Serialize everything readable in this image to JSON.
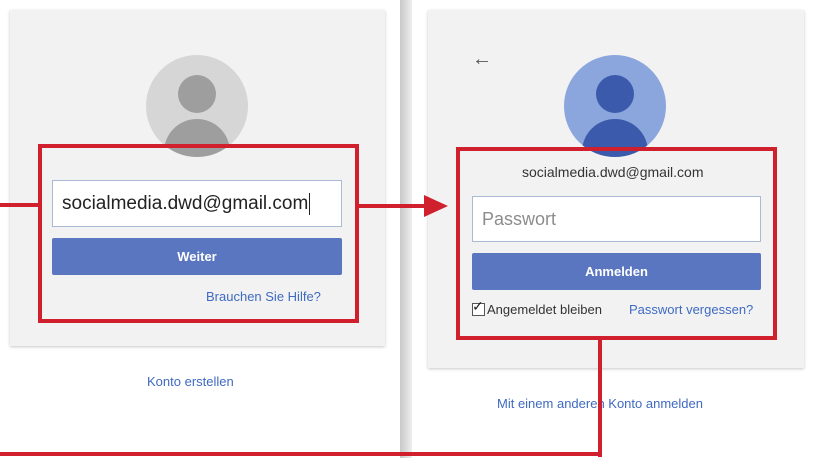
{
  "left_panel": {
    "email_value": "socialmedia.dwd@gmail.com",
    "next_button": "Weiter",
    "help_link": "Brauchen Sie Hilfe?",
    "create_account_link": "Konto erstellen"
  },
  "right_panel": {
    "back_icon": "←",
    "account_email": "socialmedia.dwd@gmail.com",
    "password_placeholder": "Passwort",
    "signin_button": "Anmelden",
    "stay_signed_in_label": "Angemeldet bleiben",
    "stay_signed_in_checked": true,
    "forgot_password_link": "Passwort vergessen?",
    "other_account_link": "Mit einem anderen Konto anmelden"
  },
  "colors": {
    "highlight": "#d0202e",
    "button": "#5a76c0",
    "link": "#3f6ac2"
  },
  "icons": [
    "default-avatar-icon",
    "user-avatar-icon",
    "back-arrow-icon",
    "checkbox-icon"
  ]
}
